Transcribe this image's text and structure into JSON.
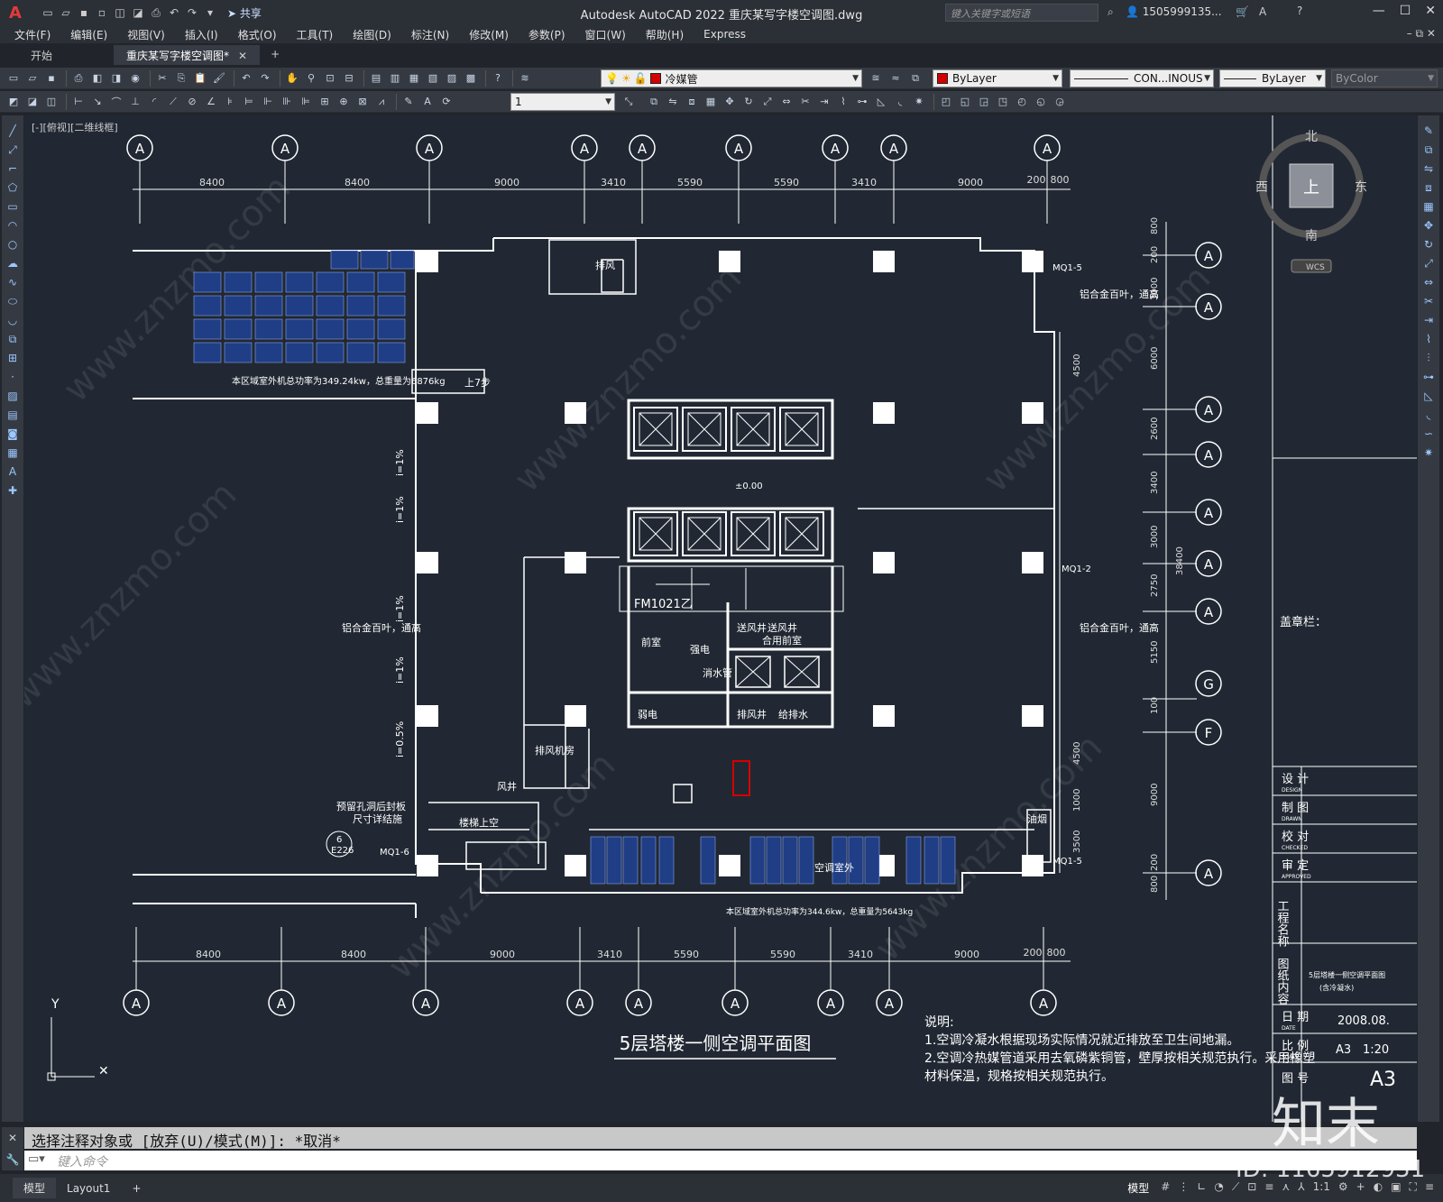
{
  "app": {
    "title": "Autodesk AutoCAD 2022    重庆某写字楼空调图.dwg",
    "share_label": "共享",
    "search_placeholder": "键入关键字或短语",
    "user": "1505999135..."
  },
  "menu": [
    "文件(F)",
    "编辑(E)",
    "视图(V)",
    "插入(I)",
    "格式(O)",
    "工具(T)",
    "绘图(D)",
    "标注(N)",
    "修改(M)",
    "参数(P)",
    "窗口(W)",
    "帮助(H)",
    "Express"
  ],
  "file_tabs": {
    "start": "开始",
    "active": "重庆某写字楼空调图*"
  },
  "toolbar": {
    "layer": "冷媒管",
    "color": "ByLayer",
    "linetype": "CON...INOUS",
    "lineweight": "ByLayer",
    "plotstyle": "ByColor",
    "dimscale": "1",
    "layer_color": "#d40000"
  },
  "view_label": "[-][俯视][二维线框]",
  "viewcube": {
    "north": "北",
    "south": "南",
    "east": "东",
    "west": "西",
    "top": "上",
    "wcs": "WCS"
  },
  "drawing": {
    "dims_top": [
      "8400",
      "8400",
      "9000",
      "3410",
      "5590",
      "5590",
      "3410",
      "9000",
      "200",
      "800"
    ],
    "dims_bottom": [
      "8400",
      "8400",
      "9000",
      "3410",
      "5590",
      "5590",
      "3410",
      "9000",
      "200",
      "800"
    ],
    "dims_right": [
      "800",
      "200",
      "3000",
      "6000",
      "4500",
      "2600",
      "3400",
      "3000",
      "2750",
      "5150",
      "100",
      "4500",
      "9000",
      "1000",
      "3500",
      "200",
      "800"
    ],
    "total_right": "38400",
    "axis_marker": "A",
    "axis_g": "G",
    "axis_f": "F",
    "title": "5层塔楼一侧空调平面图",
    "notes_title": "说明:",
    "notes": [
      "1.空调冷凝水根据现场实际情况就近排放至卫生间地漏。",
      "2.空调冷热媒管道采用去氧磷紫铜管，壁厚按相关规范执行。采用橡塑",
      "材料保温，规格按相关规范执行。"
    ],
    "left_total_note": "本区域室外机总功率为349.24kw，总重量为6876kg",
    "bottom_total_note": "本区域室外机总功率为344.6kw，总重量为5643kg",
    "rooms": {
      "smoke_exhaust": "排风",
      "stair_up": "上7步",
      "level_zero": "±0.00",
      "fm": "FM1021乙",
      "front_room": "前室",
      "power": "强电",
      "weak": "弱电",
      "fire_pipe": "消水管",
      "shaft_air": "送风井",
      "shaft_air2": "送风井",
      "combined_front": "合用前室",
      "exhaust_shaft": "排风井",
      "drainage": "给排水",
      "ahu_room": "排风机房",
      "wind_shaft": "风井",
      "stair_roof": "楼梯上空",
      "duct_shaft": "油烟",
      "ac_room": "空调室外",
      "louver_left": "铝合金百叶，通高",
      "louver_right_1": "铝合金百叶，通高",
      "louver_right_2": "铝合金百叶，通高",
      "preset_hole": "预留孔洞后封板",
      "preset_hole2": "尺寸详结施",
      "mq1_5_top": "MQ1-5",
      "mq1_2": "MQ1-2",
      "mq1_5_bot": "MQ1-5",
      "mq1_6": "MQ1-6",
      "slope_1": "i=1%",
      "slope_05": "i=0.5%",
      "ref_num": "6",
      "ref_sheet": "E226"
    }
  },
  "titleblock": {
    "stamp": "盖章栏：",
    "design": "设 计",
    "design_en": "DESIGN",
    "drawn": "制 图",
    "drawn_en": "DRAWN",
    "check": "校 对",
    "check_en": "CHECKED",
    "approve": "审 定",
    "approve_en": "APPROVED",
    "project": "工程名称",
    "content": "图纸内容",
    "content_value": "5层塔楼一侧空调平面图",
    "content_sub": "(含冷凝水)",
    "date": "日 期",
    "date_en": "DATE",
    "date_value": "2008.08.",
    "scale": "比 例",
    "scale_en": "SCALE",
    "scale_a3": "A3",
    "scale_value": "1:20",
    "sheet": "图 号",
    "sheet_value": "A3"
  },
  "command": {
    "history": "选择注释对象或 [放弃(U)/模式(M)]: *取消*",
    "placeholder": "键入命令"
  },
  "status": {
    "model_tab": "模型",
    "layout_tab": "Layout1",
    "mode": "模型",
    "scale": "1:1"
  },
  "watermark": {
    "logo": "知末",
    "id": "ID: 1165912931",
    "site": "www.znzmo.com"
  },
  "colors": {
    "background": "#212833",
    "line": "#ffffff",
    "accent_red": "#d40000",
    "units_blue": "#1f3e86"
  }
}
